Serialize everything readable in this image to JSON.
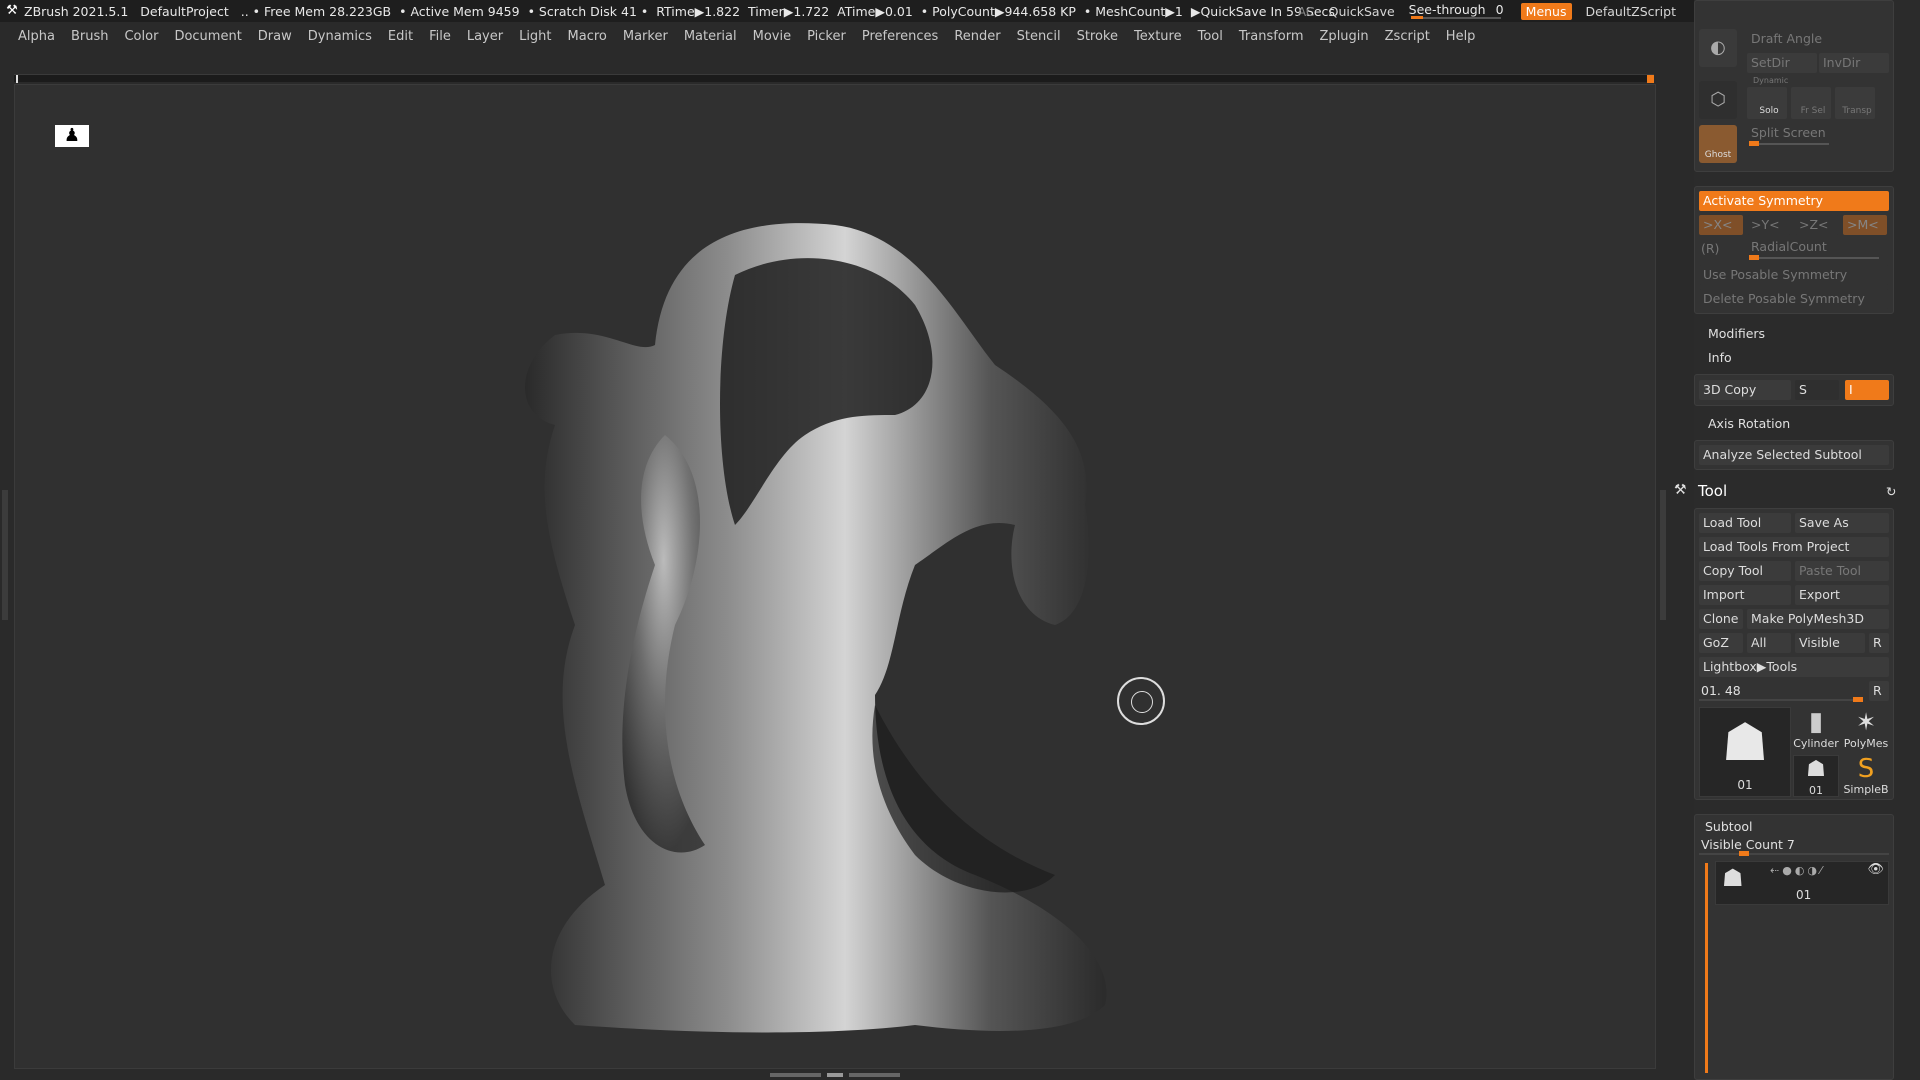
{
  "titlebar": {
    "app": "ZBrush 2021.5.1",
    "project": "DefaultProject",
    "free_mem": ".. • Free Mem 28.223GB",
    "active_mem": "• Active Mem 9459",
    "scratch": "• Scratch Disk 41 •",
    "rtime": "RTime▶1.822",
    "timer": "Timer▶1.722",
    "atime": "ATime▶0.01",
    "polycount": "• PolyCount▶944.658 KP",
    "meshcount": "• MeshCount▶1",
    "quicksave_info": "▶QuickSave In 59 Secs",
    "ac": "AC",
    "quicksave": "QuickSave",
    "see_through": "See-through",
    "see_through_value": "0",
    "menus": "Menus",
    "script": "DefaultZScript"
  },
  "menu": [
    "Alpha",
    "Brush",
    "Color",
    "Document",
    "Draw",
    "Dynamics",
    "Edit",
    "File",
    "Layer",
    "Light",
    "Macro",
    "Marker",
    "Material",
    "Movie",
    "Picker",
    "Preferences",
    "Render",
    "Stencil",
    "Stroke",
    "Texture",
    "Tool",
    "Transform",
    "Zplugin",
    "Zscript",
    "Help"
  ],
  "panel": {
    "draft_angle": "Draft Angle",
    "setdir": "SetDir",
    "invdir": "InvDir",
    "dynamic": "Dynamic",
    "solo": "Solo",
    "frsel": "Fr Sel",
    "transp": "Transp",
    "ghost": "Ghost",
    "split_screen": "Split Screen",
    "activate_symmetry": "Activate Symmetry",
    "x": ">X<",
    "y": ">Y<",
    "z": ">Z<",
    "m": ">M<",
    "r": "(R)",
    "radial_count": "RadialCount",
    "use_posable": "Use Posable Symmetry",
    "delete_posable": "Delete Posable Symmetry",
    "modifiers": "Modifiers",
    "info": "Info",
    "copy3d": "3D Copy",
    "s": "S",
    "i": "I",
    "axis_rotation": "Axis Rotation",
    "analyze": "Analyze Selected Subtool",
    "tool_title": "Tool",
    "load_tool": "Load Tool",
    "save_as": "Save As",
    "load_from_project": "Load Tools From Project",
    "copy_tool": "Copy Tool",
    "paste_tool": "Paste Tool",
    "import": "Import",
    "export": "Export",
    "clone": "Clone",
    "make_polymesh": "Make PolyMesh3D",
    "goz": "GoZ",
    "all": "All",
    "visible": "Visible",
    "r_btn": "R",
    "lightbox_tools": "Lightbox▶Tools",
    "tool_name": "01. 48",
    "thumb_main": "01",
    "thumb_cylinder": "Cylinder",
    "thumb_polymesh": "PolyMes",
    "thumb_small": "01",
    "thumb_simple": "SimpleB",
    "subtool": "Subtool",
    "visible_count": "Visible Count 7",
    "subtool_item": "01"
  },
  "colors": {
    "accent": "#f07a1a",
    "bg": "#2b2b2b",
    "canvas": "#303030"
  }
}
